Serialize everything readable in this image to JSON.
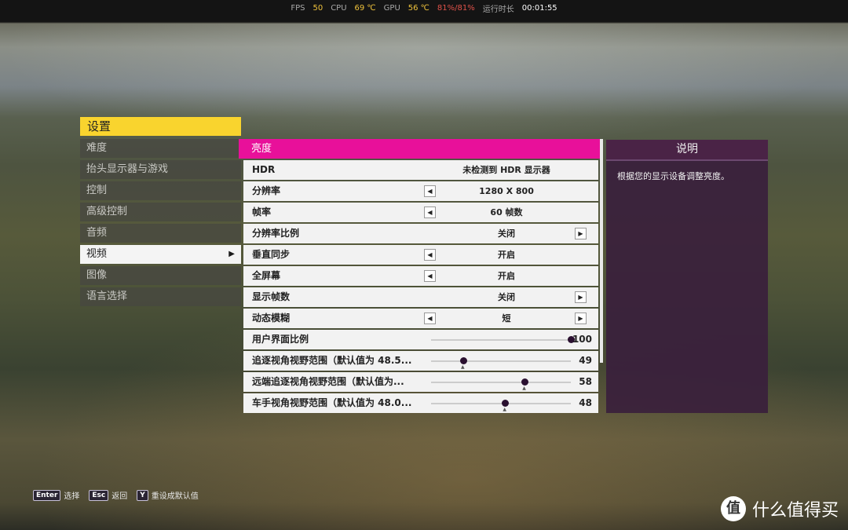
{
  "hud": {
    "fps_label": "FPS",
    "fps_value": "50",
    "cpu_label": "CPU",
    "cpu_value": "69 ℃",
    "gpu_label": "GPU",
    "gpu_value": "56 ℃",
    "gpu_load": "81%/81%",
    "runtime_label": "运行时长",
    "runtime_value": "00:01:55"
  },
  "settings": {
    "title": "设置",
    "menu": [
      {
        "label": "难度"
      },
      {
        "label": "抬头显示器与游戏"
      },
      {
        "label": "控制"
      },
      {
        "label": "高级控制"
      },
      {
        "label": "音频"
      },
      {
        "label": "视频",
        "active": true
      },
      {
        "label": "图像"
      },
      {
        "label": "语言选择"
      }
    ],
    "active_arrow": "▶"
  },
  "panel": {
    "header": "亮度",
    "rows": [
      {
        "label": "HDR",
        "value": "未检测到 HDR 显示器"
      },
      {
        "label": "分辨率",
        "value": "1280 X 800"
      },
      {
        "label": "帧率",
        "value": "60 帧数"
      },
      {
        "label": "分辨率比例",
        "value": "关闭"
      },
      {
        "label": "垂直同步",
        "value": "开启"
      },
      {
        "label": "全屏幕",
        "value": "开启"
      },
      {
        "label": "显示帧数",
        "value": "关闭"
      },
      {
        "label": "动态模糊",
        "value": "短"
      },
      {
        "label": "用户界面比例",
        "slider_value": "100",
        "fraction": 1.0,
        "default_fraction": 1.0
      },
      {
        "label": "追逐视角视野范围（默认值为 48.5...",
        "slider_value": "49",
        "fraction": 0.23,
        "default_fraction": 0.23
      },
      {
        "label": "远端追逐视角视野范围（默认值为...",
        "slider_value": "58",
        "fraction": 0.67,
        "default_fraction": 0.67
      },
      {
        "label": "车手视角视野范围（默认值为 48.0...",
        "slider_value": "48",
        "fraction": 0.53,
        "default_fraction": 0.53
      }
    ],
    "left_arrow": "◀",
    "right_arrow": "▶"
  },
  "description": {
    "title": "说明",
    "text": "根据您的显示设备调整亮度。"
  },
  "hints": [
    {
      "key": "Enter",
      "label": "选择"
    },
    {
      "key": "Esc",
      "label": "返回"
    },
    {
      "key": "Y",
      "label": "重设成默认值"
    }
  ],
  "brand": {
    "logo": "值",
    "text": "什么值得买"
  },
  "colors": {
    "accent_yellow": "#f9d42e",
    "accent_pink": "#e8109a",
    "desc_bg": "#3a203c"
  }
}
